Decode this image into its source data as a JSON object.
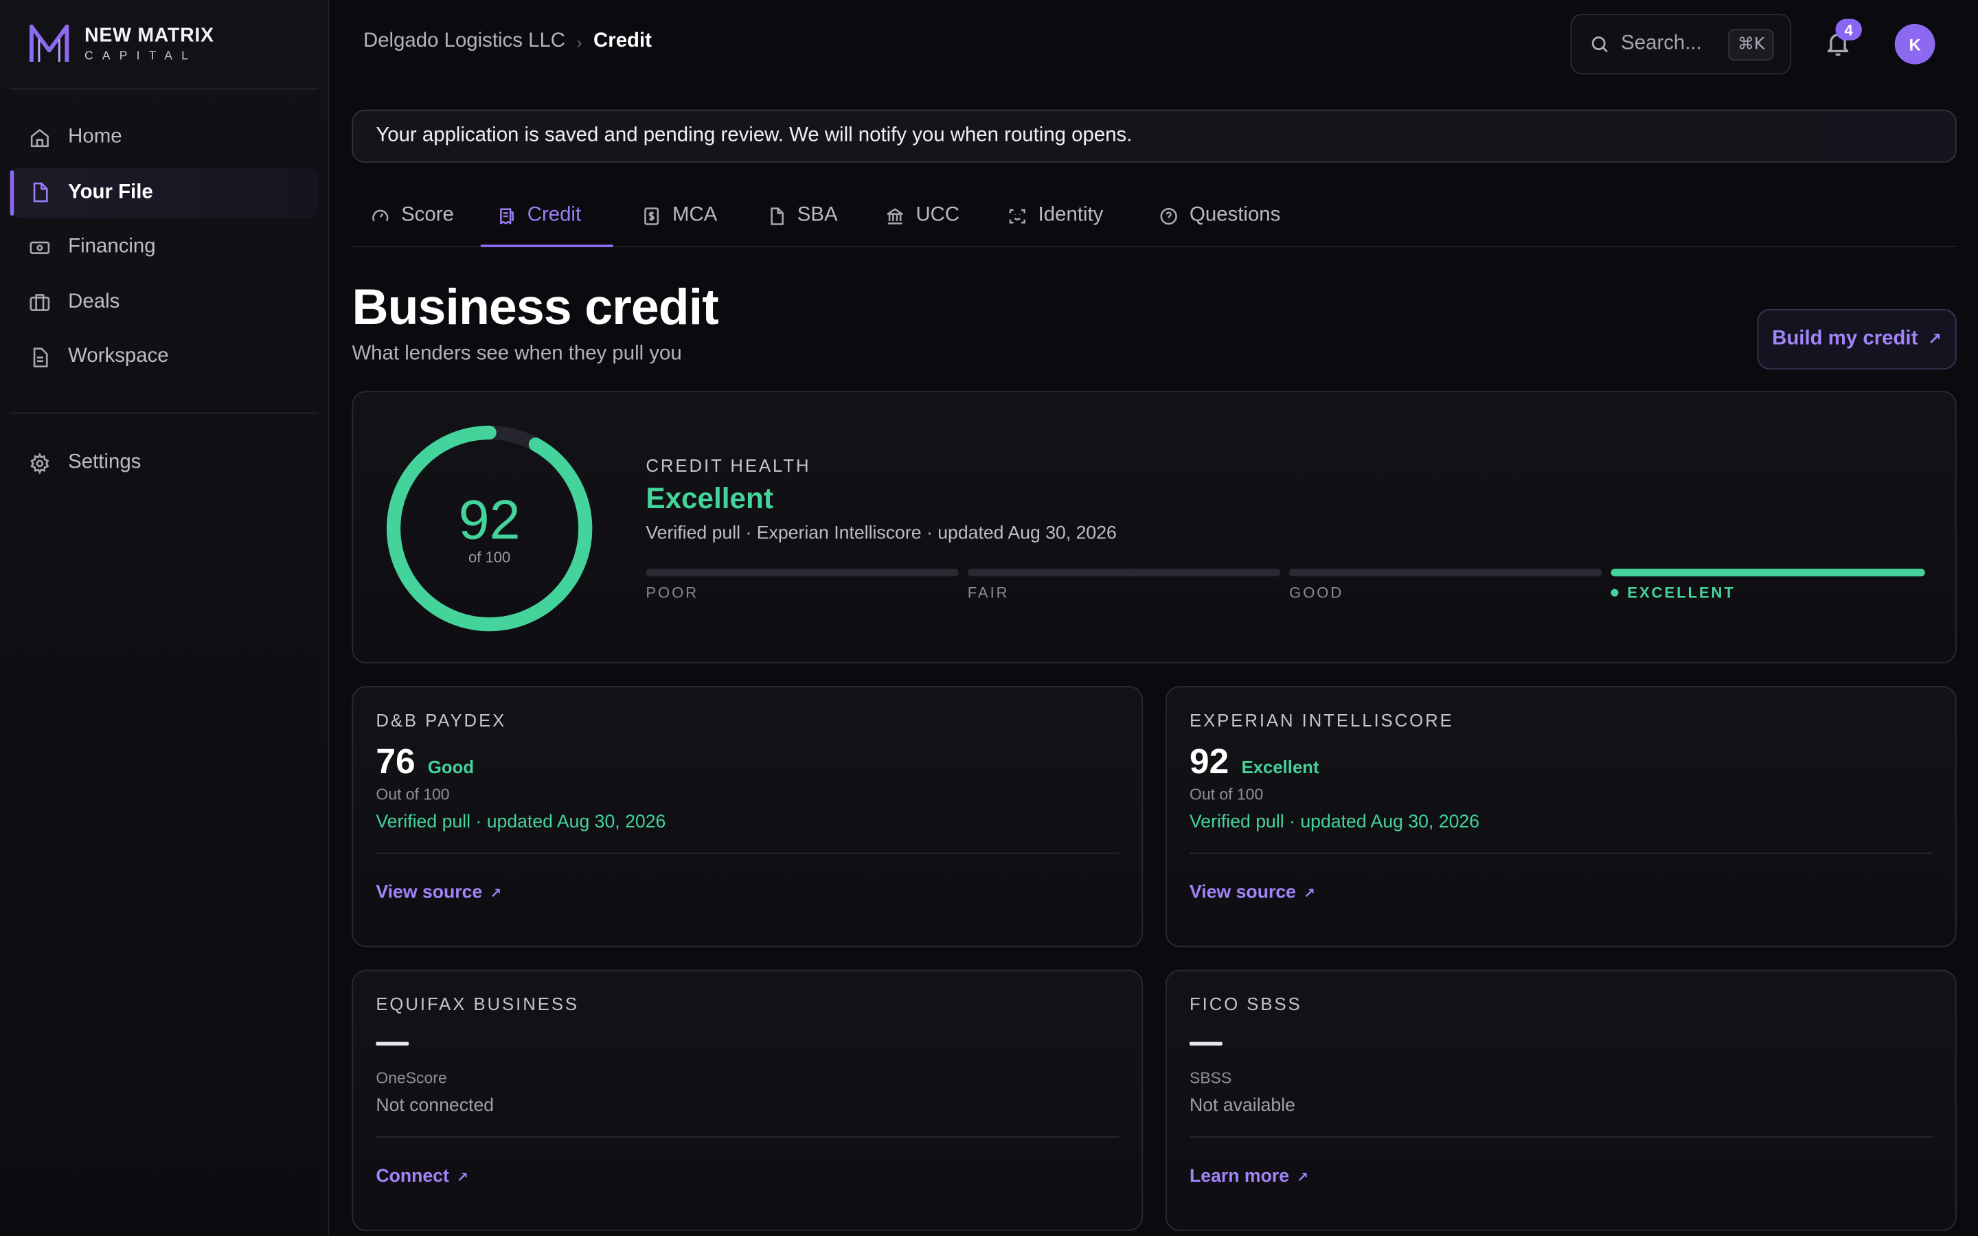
{
  "brand": {
    "name": "NEW MATRIX",
    "sub": "CAPITAL",
    "accent": "#8b6cf0"
  },
  "sidebar": {
    "items": [
      {
        "label": "Home",
        "icon": "home-icon"
      },
      {
        "label": "Your File",
        "icon": "file-icon",
        "active": true
      },
      {
        "label": "Financing",
        "icon": "banknote-icon"
      },
      {
        "label": "Deals",
        "icon": "briefcase-icon"
      },
      {
        "label": "Workspace",
        "icon": "document-icon"
      }
    ],
    "settings": {
      "label": "Settings",
      "icon": "gear-icon"
    }
  },
  "header": {
    "breadcrumb": [
      "Delgado Logistics LLC",
      "Credit"
    ],
    "search_placeholder": "Search...",
    "search_shortcut": "⌘K",
    "notifications": "4",
    "avatar_initial": "K"
  },
  "notice": "Your application is saved and pending review. We will notify you when routing opens.",
  "tabs": [
    {
      "label": "Score",
      "icon": "gauge-icon"
    },
    {
      "label": "Credit",
      "icon": "receipt-icon",
      "active": true
    },
    {
      "label": "MCA",
      "icon": "dollar-doc-icon"
    },
    {
      "label": "SBA",
      "icon": "file-icon"
    },
    {
      "label": "UCC",
      "icon": "bank-icon"
    },
    {
      "label": "Identity",
      "icon": "scan-face-icon"
    },
    {
      "label": "Questions",
      "icon": "help-circle-icon"
    }
  ],
  "page": {
    "title": "Business credit",
    "subtitle": "What lenders see when they pull you",
    "action": "Build my credit"
  },
  "health": {
    "score": "92",
    "of": "of 100",
    "score_fraction": 0.92,
    "label": "CREDIT HEALTH",
    "grade": "Excellent",
    "meta": "Verified pull · Experian Intelliscore · updated Aug 30, 2026",
    "scale": [
      "POOR",
      "FAIR",
      "GOOD",
      "EXCELLENT"
    ],
    "active_level": "EXCELLENT",
    "color": "#44d39b"
  },
  "bureaus": {
    "dnb": {
      "title": "D&B PAYDEX",
      "score": "76",
      "grade": "Good",
      "sub": "Out of 100",
      "meta": "Verified pull · updated Aug 30, 2026",
      "link": "View source"
    },
    "experian": {
      "title": "EXPERIAN INTELLISCORE",
      "score": "92",
      "grade": "Excellent",
      "sub": "Out of 100",
      "meta": "Verified pull · updated Aug 30, 2026",
      "link": "View source"
    },
    "equifax": {
      "title": "EQUIFAX BUSINESS",
      "score": "—",
      "sub": "OneScore",
      "meta": "Not connected",
      "link": "Connect"
    },
    "fico": {
      "title": "FICO SBSS",
      "score": "—",
      "sub": "SBSS",
      "meta": "Not available",
      "link": "Learn more"
    }
  }
}
